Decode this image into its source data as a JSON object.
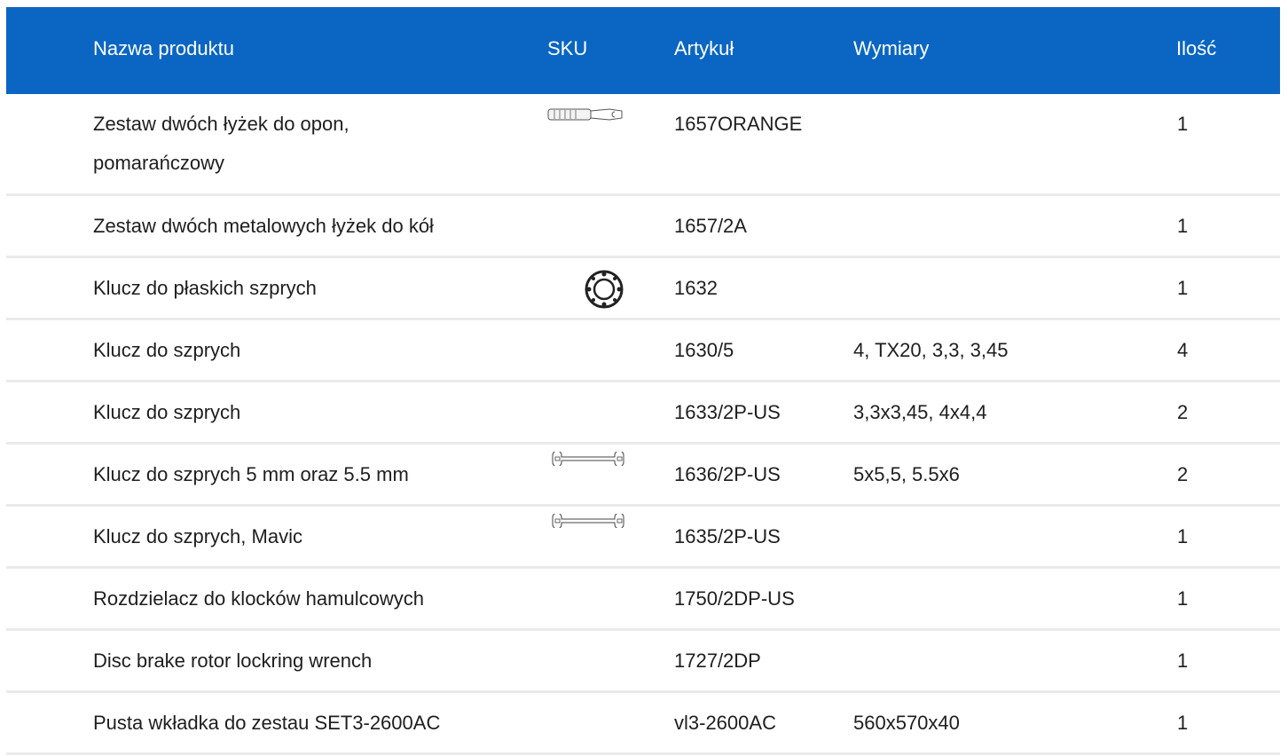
{
  "table": {
    "headers": {
      "name": "Nazwa produktu",
      "sku": "SKU",
      "article": "Artykuł",
      "dimensions": "Wymiary",
      "quantity": "Ilość"
    },
    "rows": [
      {
        "name": "Zestaw dwóch łyżek do opon, pomarańczowy",
        "sku_icon": "tire-lever-icon",
        "article": "1657ORANGE",
        "dimensions": "",
        "quantity": "1"
      },
      {
        "name": "Zestaw dwóch metalowych łyżek do kół",
        "sku_icon": "",
        "article": "1657/2A",
        "dimensions": "",
        "quantity": "1"
      },
      {
        "name": "Klucz do płaskich szprych",
        "sku_icon": "round-spoke-wrench-icon",
        "article": "1632",
        "dimensions": "",
        "quantity": "1"
      },
      {
        "name": "Klucz do szprych",
        "sku_icon": "",
        "article": "1630/5",
        "dimensions": "4, TX20, 3,3, 3,45",
        "quantity": "4"
      },
      {
        "name": "Klucz do szprych",
        "sku_icon": "",
        "article": "1633/2P-US",
        "dimensions": "3,3x3,45, 4x4,4",
        "quantity": "2"
      },
      {
        "name": "Klucz do szprych 5 mm oraz 5.5 mm",
        "sku_icon": "double-end-wrench-icon",
        "article": "1636/2P-US",
        "dimensions": "5x5,5, 5.5x6",
        "quantity": "2"
      },
      {
        "name": "Klucz do szprych, Mavic",
        "sku_icon": "double-end-wrench-icon",
        "article": "1635/2P-US",
        "dimensions": "",
        "quantity": "1"
      },
      {
        "name": "Rozdzielacz do klocków hamulcowych",
        "sku_icon": "",
        "article": "1750/2DP-US",
        "dimensions": "",
        "quantity": "1"
      },
      {
        "name": "Disc brake rotor lockring wrench",
        "sku_icon": "",
        "article": "1727/2DP",
        "dimensions": "",
        "quantity": "1"
      },
      {
        "name": "Pusta wkładka do zestau SET3-2600AC",
        "sku_icon": "",
        "article": "vl3-2600AC",
        "dimensions": "560x570x40",
        "quantity": "1"
      }
    ]
  },
  "colors": {
    "header_bg": "#0a66c2",
    "header_text": "#ffffff",
    "row_divider": "#eaeaea"
  }
}
